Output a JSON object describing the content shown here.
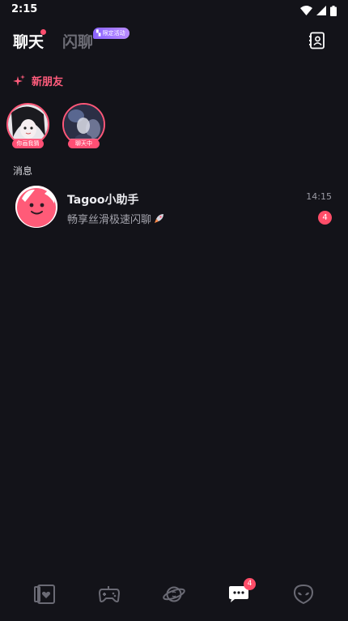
{
  "status_bar": {
    "time": "2:15"
  },
  "header": {
    "tab_chat": "聊天",
    "tab_flash": "闪聊",
    "flash_badge": "限定活动"
  },
  "new_friends": {
    "label": "新朋友",
    "friends": [
      {
        "tag": "你画我猜"
      },
      {
        "tag": "聊天中"
      }
    ]
  },
  "messages": {
    "section_title": "消息",
    "items": [
      {
        "name": "Tagoo小助手",
        "preview": "畅享丝滑极速闪聊",
        "time": "14:15",
        "unread": "4"
      }
    ]
  },
  "bottom_nav": {
    "items": [
      {
        "icon": "cards-icon"
      },
      {
        "icon": "gamepad-icon"
      },
      {
        "icon": "planet-icon"
      },
      {
        "icon": "chat-icon",
        "badge": "4",
        "active": true
      },
      {
        "icon": "alien-icon"
      }
    ]
  },
  "colors": {
    "background": "#131319",
    "accent": "#ff4d6d",
    "badge": "#ff4d68",
    "muted": "#6d6d76"
  }
}
